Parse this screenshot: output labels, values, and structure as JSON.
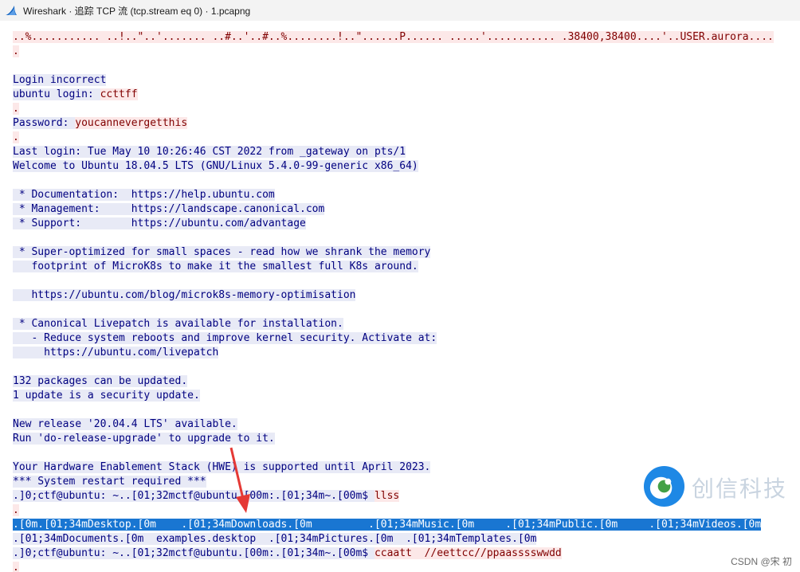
{
  "window": {
    "title": "Wireshark · 追踪 TCP 流 (tcp.stream eq 0) · 1.pcapng"
  },
  "stream_lines": [
    {
      "t": "s",
      "text": "..%........... ..!..\"..'....... ..#..'..#..%........!..\"......P...... .....'........... .38400,38400....'..USER.aurora...."
    },
    {
      "t": "s",
      "text": "."
    },
    {
      "t": "c",
      "text": ""
    },
    {
      "t": "c",
      "text": "Login incorrect"
    },
    {
      "t": "c",
      "text": "ubuntu login: ",
      "s": "ccttff"
    },
    {
      "t": "s",
      "text": "."
    },
    {
      "t": "c",
      "text": "Password: ",
      "s": "youcannevergetthis"
    },
    {
      "t": "s",
      "text": "."
    },
    {
      "t": "c",
      "text": "Last login: Tue May 10 10:26:46 CST 2022 from _gateway on pts/1"
    },
    {
      "t": "c",
      "text": "Welcome to Ubuntu 18.04.5 LTS (GNU/Linux 5.4.0-99-generic x86_64)"
    },
    {
      "t": "c",
      "text": ""
    },
    {
      "t": "c",
      "text": " * Documentation:  https://help.ubuntu.com"
    },
    {
      "t": "c",
      "text": " * Management:     https://landscape.canonical.com"
    },
    {
      "t": "c",
      "text": " * Support:        https://ubuntu.com/advantage"
    },
    {
      "t": "c",
      "text": ""
    },
    {
      "t": "c",
      "text": " * Super-optimized for small spaces - read how we shrank the memory"
    },
    {
      "t": "c",
      "text": "   footprint of MicroK8s to make it the smallest full K8s around."
    },
    {
      "t": "c",
      "text": ""
    },
    {
      "t": "c",
      "text": "   https://ubuntu.com/blog/microk8s-memory-optimisation"
    },
    {
      "t": "c",
      "text": ""
    },
    {
      "t": "c",
      "text": " * Canonical Livepatch is available for installation."
    },
    {
      "t": "c",
      "text": "   - Reduce system reboots and improve kernel security. Activate at:"
    },
    {
      "t": "c",
      "text": "     https://ubuntu.com/livepatch"
    },
    {
      "t": "c",
      "text": ""
    },
    {
      "t": "c",
      "text": "132 packages can be updated."
    },
    {
      "t": "c",
      "text": "1 update is a security update."
    },
    {
      "t": "c",
      "text": ""
    },
    {
      "t": "c",
      "text": "New release '20.04.4 LTS' available."
    },
    {
      "t": "c",
      "text": "Run 'do-release-upgrade' to upgrade to it."
    },
    {
      "t": "c",
      "text": ""
    },
    {
      "t": "c",
      "text": "Your Hardware Enablement Stack (HWE) is supported until April 2023."
    },
    {
      "t": "c",
      "text": "*** System restart required ***"
    },
    {
      "t": "c",
      "text": ".]0;ctf@ubuntu: ~..[01;32mctf@ubuntu.[00m:.[01;34m~.[00m$ ",
      "s": "llss"
    },
    {
      "t": "s",
      "text": "."
    },
    {
      "t": "sel",
      "text": ".[0m.[01;34mDesktop.[0m    .[01;34mDownloads.[0m         .[01;34mMusic.[0m     .[01;34mPublic.[0m     .[01;34mVideos.[0m"
    },
    {
      "t": "c",
      "text": ".[01;34mDocuments.[0m  examples.desktop  .[01;34mPictures.[0m  .[01;34mTemplates.[0m"
    },
    {
      "t": "c",
      "text": ".]0;ctf@ubuntu: ~..[01;32mctf@ubuntu.[00m:.[01;34m~.[00m$ ",
      "s": "ccaatt  //eettcc//ppaasssswwdd"
    },
    {
      "t": "s",
      "text": "."
    }
  ],
  "watermark": {
    "text": "创信科技",
    "credit": "CSDN @宋 初"
  },
  "colors": {
    "client_text": "#000080",
    "client_bg": "#e8eaf6",
    "server_text": "#800000",
    "server_bg": "#fce8e8",
    "selection_bg": "#1976d2",
    "annotation_arrow": "#e53935"
  }
}
